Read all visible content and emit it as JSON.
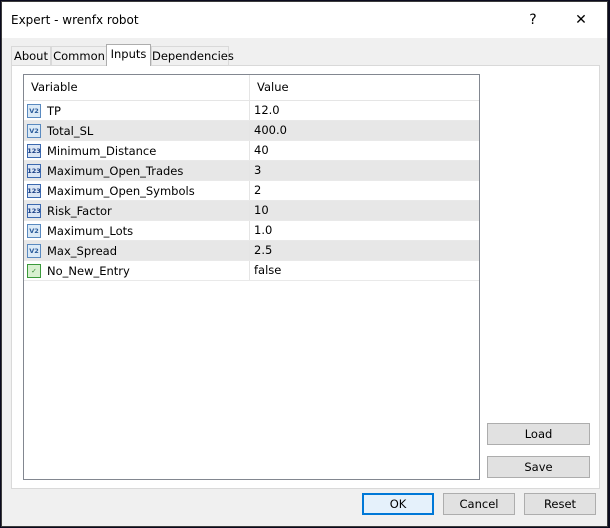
{
  "window": {
    "title": "Expert - wrenfx robot",
    "help_glyph": "?",
    "close_glyph": "✕"
  },
  "tabs": [
    {
      "label": "About",
      "active": false
    },
    {
      "label": "Common",
      "active": false
    },
    {
      "label": "Inputs",
      "active": true
    },
    {
      "label": "Dependencies",
      "active": false
    }
  ],
  "grid": {
    "headers": {
      "variable": "Variable",
      "value": "Value"
    },
    "rows": [
      {
        "icon": "double-icon",
        "icon_text": "V2",
        "variable": "TP",
        "value": "12.0"
      },
      {
        "icon": "double-icon",
        "icon_text": "V2",
        "variable": "Total_SL",
        "value": "400.0"
      },
      {
        "icon": "integer-icon",
        "icon_text": "123",
        "variable": "Minimum_Distance",
        "value": "40"
      },
      {
        "icon": "integer-icon",
        "icon_text": "123",
        "variable": "Maximum_Open_Trades",
        "value": "3"
      },
      {
        "icon": "integer-icon",
        "icon_text": "123",
        "variable": "Maximum_Open_Symbols",
        "value": "2"
      },
      {
        "icon": "integer-icon",
        "icon_text": "123",
        "variable": "Risk_Factor",
        "value": "10"
      },
      {
        "icon": "double-icon",
        "icon_text": "V2",
        "variable": "Maximum_Lots",
        "value": "1.0"
      },
      {
        "icon": "double-icon",
        "icon_text": "V2",
        "variable": "Max_Spread",
        "value": "2.5"
      },
      {
        "icon": "bool-icon",
        "icon_text": "✓",
        "variable": "No_New_Entry",
        "value": "false"
      }
    ]
  },
  "side_buttons": {
    "load": "Load",
    "save": "Save"
  },
  "footer_buttons": {
    "ok": "OK",
    "cancel": "Cancel",
    "reset": "Reset"
  },
  "colors": {
    "accent": "#0078d7",
    "alt_row": "#e7e7e7"
  }
}
